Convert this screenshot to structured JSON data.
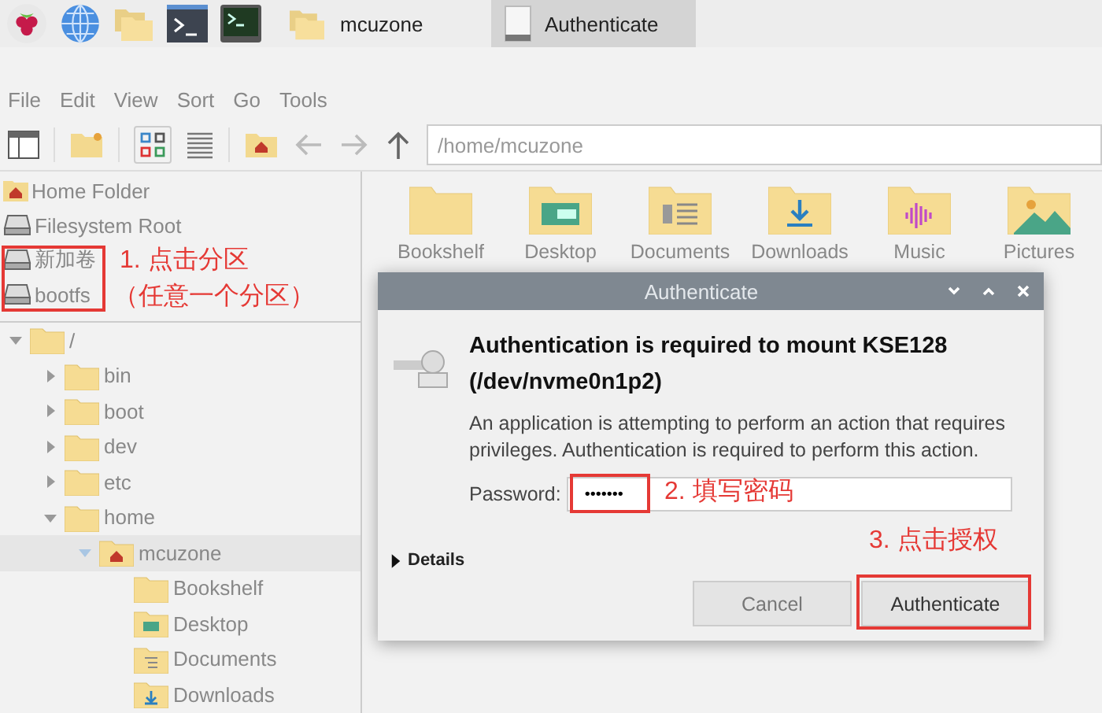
{
  "taskbar": {
    "tasks": [
      {
        "label": "mcuzone",
        "kind": "folder",
        "selected": false
      },
      {
        "label": "Authenticate",
        "kind": "document",
        "selected": true
      }
    ]
  },
  "menu": [
    "File",
    "Edit",
    "View",
    "Sort",
    "Go",
    "Tools"
  ],
  "toolbar": {
    "path": "/home/mcuzone"
  },
  "places": [
    {
      "label": "Home Folder",
      "kind": "home"
    },
    {
      "label": "Filesystem Root",
      "kind": "drive"
    },
    {
      "label": "新加卷",
      "kind": "drive"
    },
    {
      "label": "bootfs",
      "kind": "drive"
    }
  ],
  "tree": [
    {
      "label": "/",
      "expanded": true,
      "selected": false,
      "children": [
        {
          "label": "bin",
          "expanded": false,
          "selected": false
        },
        {
          "label": "boot",
          "expanded": false,
          "selected": false
        },
        {
          "label": "dev",
          "expanded": false,
          "selected": false
        },
        {
          "label": "etc",
          "expanded": false,
          "selected": false
        },
        {
          "label": "home",
          "expanded": true,
          "selected": false,
          "children": [
            {
              "label": "mcuzone",
              "kind": "home",
              "expanded": true,
              "selected": true,
              "children": [
                {
                  "label": "Bookshelf",
                  "selected": false
                },
                {
                  "label": "Desktop",
                  "kind": "desktop",
                  "selected": false
                },
                {
                  "label": "Documents",
                  "kind": "documents",
                  "selected": false
                },
                {
                  "label": "Downloads",
                  "kind": "downloads",
                  "selected": false
                }
              ]
            }
          ]
        }
      ]
    }
  ],
  "files": [
    {
      "label": "Bookshelf"
    },
    {
      "label": "Desktop",
      "kind": "desktop"
    },
    {
      "label": "Documents",
      "kind": "documents"
    },
    {
      "label": "Downloads",
      "kind": "downloads"
    },
    {
      "label": "Music",
      "kind": "music"
    },
    {
      "label": "Pictures",
      "kind": "pictures"
    }
  ],
  "dialog": {
    "title": "Authenticate",
    "heading": "Authentication is required to mount KSE128 (/dev/nvme0n1p2)",
    "message": "An application is attempting to perform an action that requires privileges. Authentication is required to perform this action.",
    "password_label": "Password:",
    "password_value": "•••••••",
    "details": "Details",
    "details_expanded": false,
    "buttons": [
      {
        "label": "Cancel",
        "default": false
      },
      {
        "label": "Authenticate",
        "default": true
      }
    ]
  },
  "annotations": [
    {
      "text": "1. 点击分区"
    },
    {
      "text": "（任意一个分区）"
    },
    {
      "text": "2. 填写密码"
    },
    {
      "text": "3. 点击授权"
    }
  ]
}
